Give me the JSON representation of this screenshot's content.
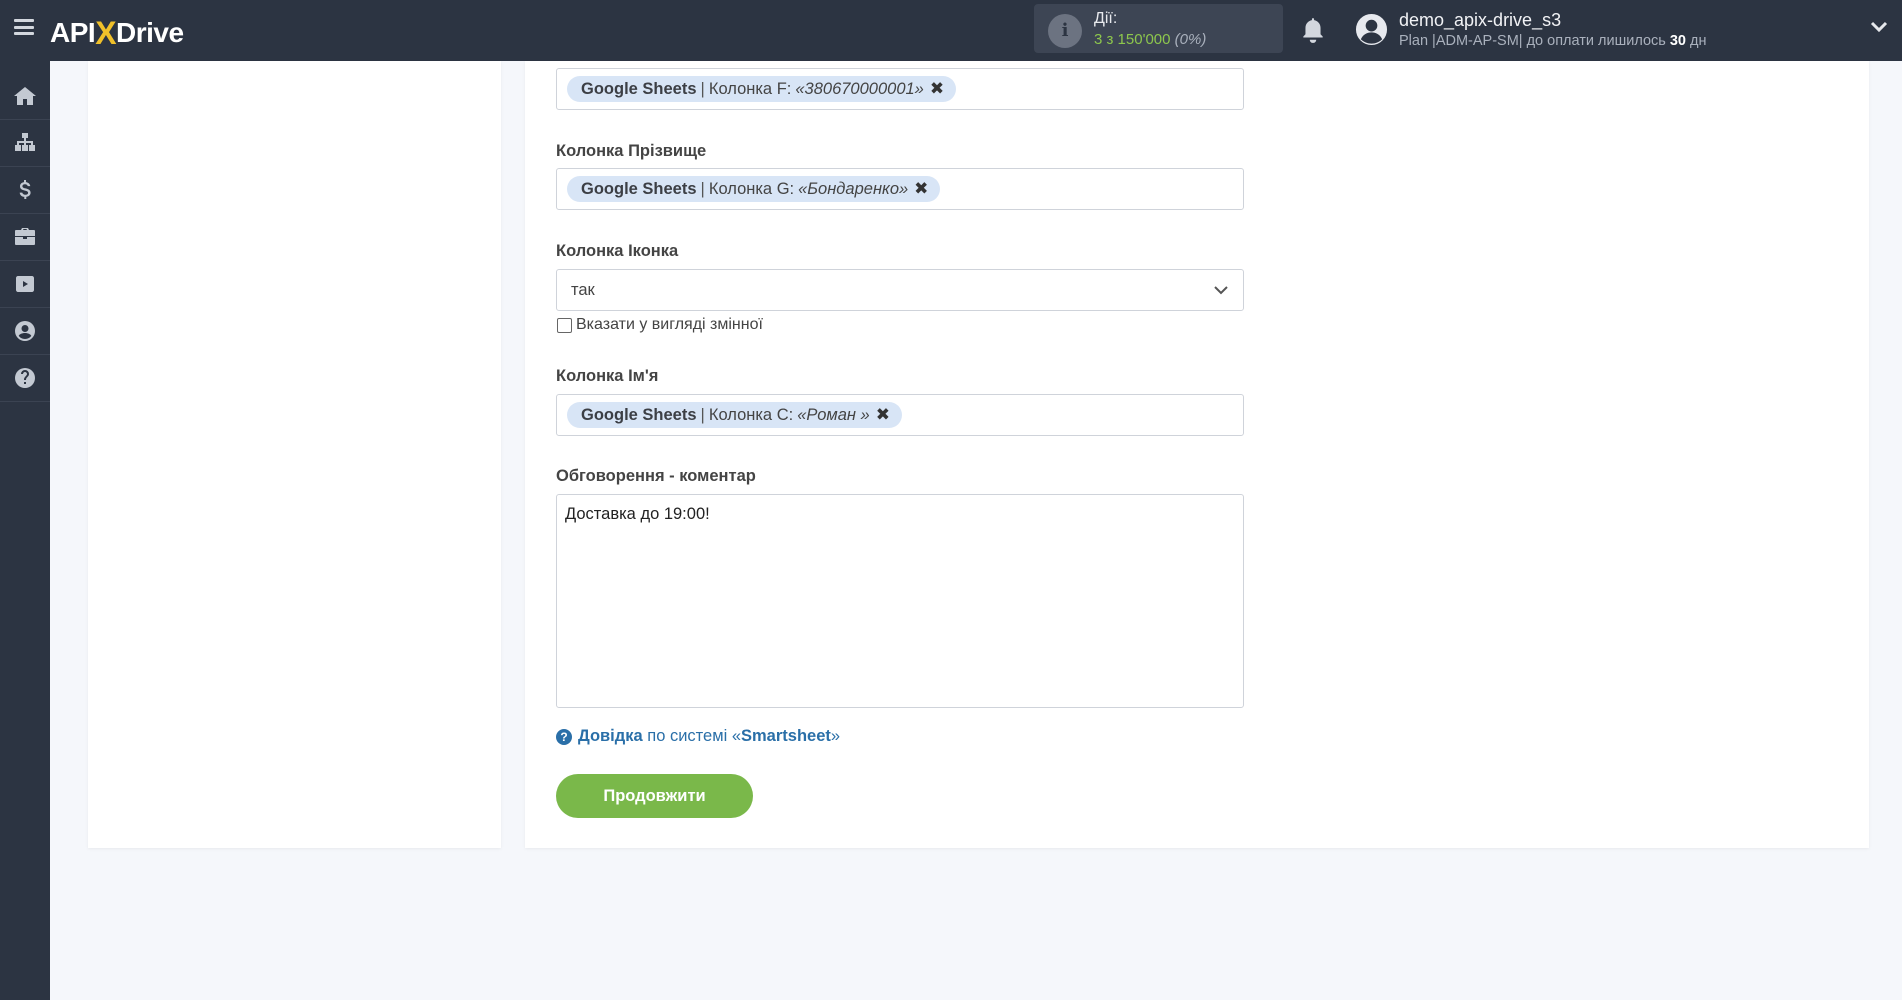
{
  "header": {
    "logo": {
      "prefix": "API",
      "x": "X",
      "suffix": "Drive"
    },
    "actions": {
      "label": "Дії:",
      "used_prefix": "3 з 150'000",
      "percent": "(0%)"
    },
    "user": {
      "name": "demo_apix-drive_s3",
      "plan_text": "Plan |ADM-AP-SM| до оплати лишилось",
      "days": "30",
      "days_unit": "дн"
    }
  },
  "sidebar": {
    "items": [
      {
        "icon": "home-icon"
      },
      {
        "icon": "sitemap-icon"
      },
      {
        "icon": "dollar-icon"
      },
      {
        "icon": "briefcase-icon"
      },
      {
        "icon": "youtube-icon"
      },
      {
        "icon": "user-circle-icon"
      },
      {
        "icon": "question-icon"
      }
    ]
  },
  "form": {
    "phone_field": {
      "tag": {
        "source": "Google Sheets",
        "separator": "|",
        "column": "Колонка F:",
        "value": "«380670000001»",
        "remove": "✖"
      }
    },
    "surname_field": {
      "label": "Колонка Прізвище",
      "tag": {
        "source": "Google Sheets",
        "separator": "|",
        "column": "Колонка G:",
        "value": "«Бондаренко»",
        "remove": "✖"
      }
    },
    "icon_field": {
      "label": "Колонка Іконка",
      "selected": "так",
      "checkbox_label": "Вказати у вигляді змінної",
      "checked": false
    },
    "name_field": {
      "label": "Колонка Ім'я",
      "tag": {
        "source": "Google Sheets",
        "separator": "|",
        "column": "Колонка C:",
        "value": "«Роман »",
        "remove": "✖"
      }
    },
    "comment_field": {
      "label": "Обговорення - коментар",
      "value": "Доставка до 19:00!"
    },
    "help": {
      "link": "Довідка",
      "middle": "по системі «",
      "system": "Smartsheet",
      "end": "»"
    },
    "continue_label": "Продовжити"
  },
  "colors": {
    "topbar": "#2c3442",
    "accent_green": "#7ab84a",
    "tag_bg": "#d8e5f6",
    "link_blue": "#2a6fa8",
    "logo_x": "#f0c02a"
  }
}
